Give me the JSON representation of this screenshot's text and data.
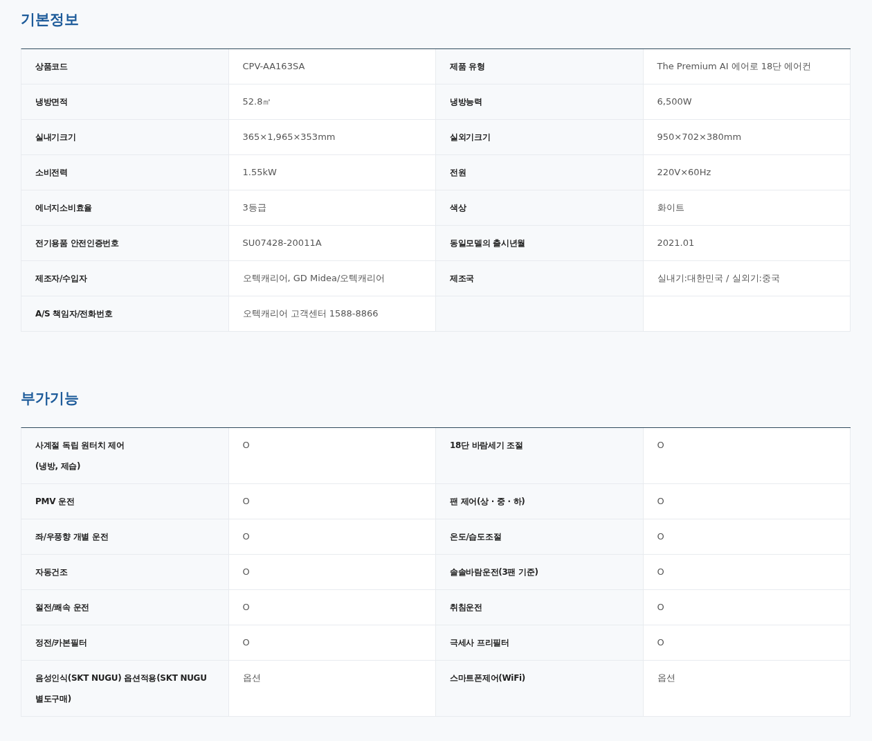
{
  "sections": [
    {
      "title": "기본정보",
      "rows": [
        {
          "cells": [
            {
              "label": "상품코드",
              "value": "CPV-AA163SA"
            },
            {
              "label": "제품 유형",
              "value": "The Premium AI 에어로 18단 에어컨"
            }
          ]
        },
        {
          "cells": [
            {
              "label": "냉방면적",
              "value": "52.8㎡"
            },
            {
              "label": "냉방능력",
              "value": "6,500W"
            }
          ]
        },
        {
          "cells": [
            {
              "label": "실내기크기",
              "value": "365×1,965×353mm"
            },
            {
              "label": "실외기크기",
              "value": "950×702×380mm"
            }
          ]
        },
        {
          "cells": [
            {
              "label": "소비전력",
              "value": "1.55kW"
            },
            {
              "label": "전원",
              "value": "220V×60Hz"
            }
          ]
        },
        {
          "cells": [
            {
              "label": "에너지소비효율",
              "value": "3등급"
            },
            {
              "label": "색상",
              "value": "화이트"
            }
          ]
        },
        {
          "cells": [
            {
              "label": "전기용품 안전인증번호",
              "value": "SU07428-20011A"
            },
            {
              "label": "동일모델의 출시년월",
              "value": "2021.01"
            }
          ]
        },
        {
          "cells": [
            {
              "label": "제조자/수입자",
              "value": "오텍캐리어, GD Midea/오텍캐리어"
            },
            {
              "label": "제조국",
              "value": "실내기:대한민국 / 실외기:중국"
            }
          ]
        },
        {
          "cells": [
            {
              "label": "A/S 책임자/전화번호",
              "value": "오텍캐리어 고객센터 1588-8866"
            }
          ]
        }
      ]
    },
    {
      "title": "부가기능",
      "rows": [
        {
          "cells": [
            {
              "label": "사계절 독립 원터치 제어\n(냉방, 제습)",
              "value": "O"
            },
            {
              "label": "18단 바람세기 조절",
              "value": "O"
            }
          ]
        },
        {
          "cells": [
            {
              "label": "PMV 운전",
              "value": "O"
            },
            {
              "label": "팬 제어(상 · 중 · 하)",
              "value": "O"
            }
          ]
        },
        {
          "cells": [
            {
              "label": "좌/우풍향 개별 운전",
              "value": "O"
            },
            {
              "label": "온도/습도조절",
              "value": "O"
            }
          ]
        },
        {
          "cells": [
            {
              "label": "자동건조",
              "value": "O"
            },
            {
              "label": "솔솔바람운전(3팬 기준)",
              "value": "O"
            }
          ]
        },
        {
          "cells": [
            {
              "label": "절전/쾌속 운전",
              "value": "O"
            },
            {
              "label": "취침운전",
              "value": "O"
            }
          ]
        },
        {
          "cells": [
            {
              "label": "정전/카본필터",
              "value": "O"
            },
            {
              "label": "극세사 프리필터",
              "value": "O"
            }
          ]
        },
        {
          "cells": [
            {
              "label": "음성인식(SKT NUGU) 옵션적용(SKT NUGU\n별도구매)",
              "value": "옵션"
            },
            {
              "label": "스마트폰제어(WiFi)",
              "value": "옵션"
            }
          ]
        }
      ]
    }
  ]
}
